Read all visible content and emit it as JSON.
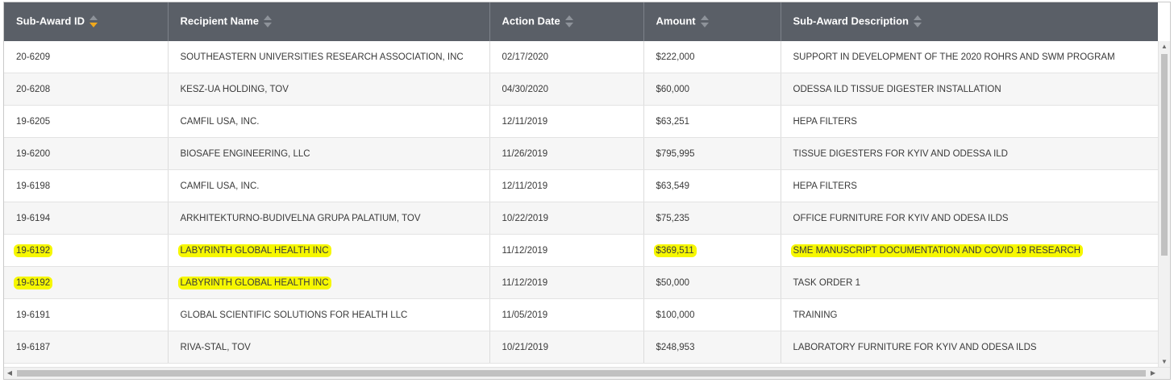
{
  "table": {
    "headers": [
      {
        "label": "Sub-Award ID",
        "active_sort": true
      },
      {
        "label": "Recipient Name",
        "active_sort": false
      },
      {
        "label": "Action Date",
        "active_sort": false
      },
      {
        "label": "Amount",
        "active_sort": false
      },
      {
        "label": "Sub-Award Description",
        "active_sort": false
      }
    ],
    "rows": [
      {
        "cells": [
          "20-6209",
          "SOUTHEASTERN UNIVERSITIES RESEARCH ASSOCIATION, INC",
          "02/17/2020",
          "$222,000",
          "SUPPORT IN DEVELOPMENT OF THE 2020 ROHRS AND SWM PROGRAM"
        ],
        "highlight": [
          false,
          false,
          false,
          false,
          false
        ]
      },
      {
        "cells": [
          "20-6208",
          "KESZ-UA HOLDING, TOV",
          "04/30/2020",
          "$60,000",
          "ODESSA ILD TISSUE DIGESTER INSTALLATION"
        ],
        "highlight": [
          false,
          false,
          false,
          false,
          false
        ]
      },
      {
        "cells": [
          "19-6205",
          "CAMFIL USA, INC.",
          "12/11/2019",
          "$63,251",
          "HEPA FILTERS"
        ],
        "highlight": [
          false,
          false,
          false,
          false,
          false
        ]
      },
      {
        "cells": [
          "19-6200",
          "BIOSAFE ENGINEERING, LLC",
          "11/26/2019",
          "$795,995",
          "TISSUE DIGESTERS FOR KYIV AND ODESSA ILD"
        ],
        "highlight": [
          false,
          false,
          false,
          false,
          false
        ]
      },
      {
        "cells": [
          "19-6198",
          "CAMFIL USA, INC.",
          "12/11/2019",
          "$63,549",
          "HEPA FILTERS"
        ],
        "highlight": [
          false,
          false,
          false,
          false,
          false
        ]
      },
      {
        "cells": [
          "19-6194",
          "ARKHITEKTURNO-BUDIVELNA GRUPA PALATIUM, TOV",
          "10/22/2019",
          "$75,235",
          "OFFICE FURNITURE FOR KYIV AND ODESA ILDS"
        ],
        "highlight": [
          false,
          false,
          false,
          false,
          false
        ]
      },
      {
        "cells": [
          "19-6192",
          "LABYRINTH GLOBAL HEALTH INC",
          "11/12/2019",
          "$369,511",
          "SME MANUSCRIPT DOCUMENTATION AND COVID 19 RESEARCH"
        ],
        "highlight": [
          true,
          true,
          false,
          true,
          true
        ]
      },
      {
        "cells": [
          "19-6192",
          "LABYRINTH GLOBAL HEALTH INC",
          "11/12/2019",
          "$50,000",
          "TASK ORDER 1"
        ],
        "highlight": [
          true,
          true,
          false,
          false,
          false
        ]
      },
      {
        "cells": [
          "19-6191",
          "GLOBAL SCIENTIFIC SOLUTIONS FOR HEALTH LLC",
          "11/05/2019",
          "$100,000",
          "TRAINING"
        ],
        "highlight": [
          false,
          false,
          false,
          false,
          false
        ]
      },
      {
        "cells": [
          "19-6187",
          "RIVA-STAL, TOV",
          "10/21/2019",
          "$248,953",
          "LABORATORY FURNITURE FOR KYIV AND ODESA ILDS"
        ],
        "highlight": [
          false,
          false,
          false,
          false,
          false
        ]
      }
    ]
  },
  "colors": {
    "header_bg": "#5a5f67",
    "sort_active": "#f0a81c",
    "highlight": "#f6f700"
  }
}
